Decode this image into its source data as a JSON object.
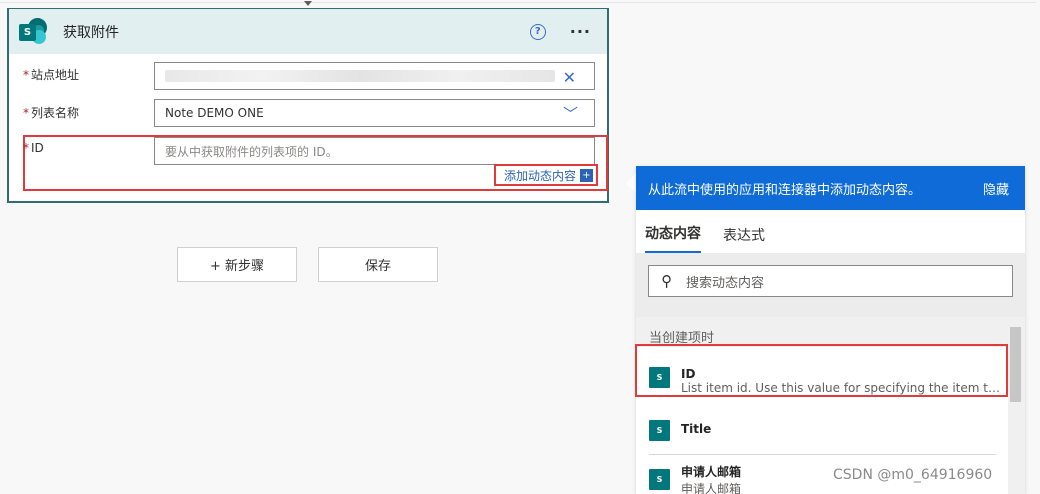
{
  "card": {
    "title": "获取附件",
    "help_glyph": "?",
    "more_glyph": "···",
    "fields": {
      "site": {
        "label": "站点地址",
        "clear_glyph": "✕"
      },
      "list": {
        "label": "列表名称",
        "value": "Note DEMO ONE",
        "chevron_glyph": "﹀"
      },
      "id": {
        "label": "ID",
        "placeholder": "要从中获取附件的列表项的 ID。"
      }
    },
    "required_mark": "*",
    "add_dynamic": {
      "label": "添加动态内容",
      "plus": "+"
    }
  },
  "buttons": {
    "new_step": "+ 新步骤",
    "save": "保存"
  },
  "panel": {
    "header": "从此流中使用的应用和连接器中添加动态内容。",
    "hide": "隐藏",
    "tabs": [
      "动态内容",
      "表达式"
    ],
    "search_placeholder": "搜索动态内容",
    "section": "当创建项时",
    "logo_letter": "S",
    "items": [
      {
        "name": "ID",
        "desc": "List item id. Use this value for specifying the item to act on in other list related actions."
      },
      {
        "name": "Title",
        "desc": ""
      },
      {
        "name": "申请人邮箱",
        "desc": "申请人邮箱"
      }
    ]
  },
  "watermark": "CSDN @m0_64916960",
  "colors": {
    "accent": "#0f6bd8",
    "card_border": "#336b72",
    "highlight": "#e03a3a"
  }
}
